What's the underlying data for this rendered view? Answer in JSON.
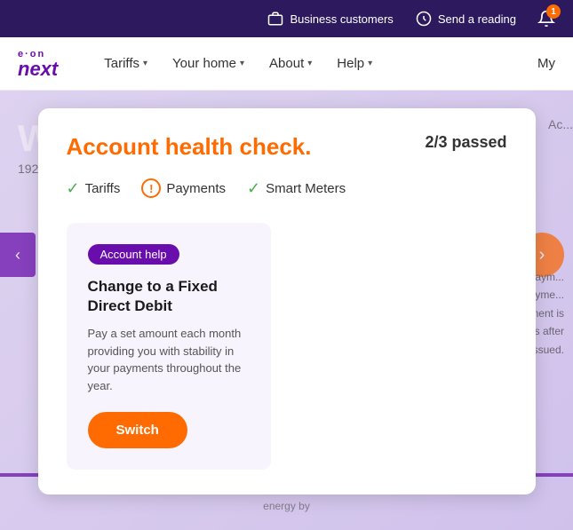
{
  "topbar": {
    "business_customers_label": "Business customers",
    "send_reading_label": "Send a reading",
    "notification_count": "1"
  },
  "navbar": {
    "logo_eon": "e·on",
    "logo_next": "next",
    "tariffs_label": "Tariffs",
    "your_home_label": "Your home",
    "about_label": "About",
    "help_label": "Help",
    "my_label": "My"
  },
  "page": {
    "welcome_text": "Wo...",
    "address_text": "192 G...",
    "account_label": "Ac..."
  },
  "modal": {
    "title": "Account health check.",
    "score_label": "2/3 passed",
    "checks": [
      {
        "label": "Tariffs",
        "status": "pass"
      },
      {
        "label": "Payments",
        "status": "warning"
      },
      {
        "label": "Smart Meters",
        "status": "pass"
      }
    ]
  },
  "card": {
    "tag_label": "Account help",
    "title": "Change to a Fixed Direct Debit",
    "description": "Pay a set amount each month providing you with stability in your payments throughout the year.",
    "button_label": "Switch"
  },
  "right_panel": {
    "next_payment_text": "t paym...",
    "payment_detail1": "payme...",
    "payment_detail2": "ment is",
    "payment_detail3": "s after",
    "payment_detail4": "issued.",
    "energy_by": "energy by"
  }
}
